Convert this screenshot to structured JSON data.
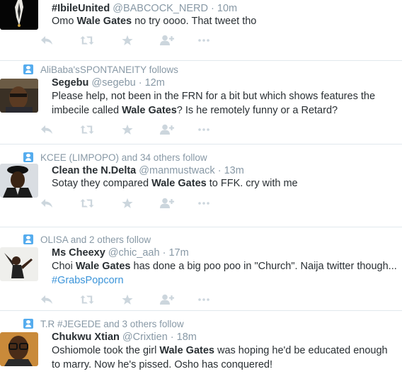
{
  "colors": {
    "icon": "#ccd6dd",
    "accent": "#55acee",
    "link": "#3b94d9",
    "muted": "#8899a6",
    "text": "#292f33",
    "divider": "#e1e8ed"
  },
  "tweets": [
    {
      "social": "",
      "fullname": "#IbileUnited",
      "username": "@BABCOCK_NERD",
      "sep": " · ",
      "time": "10m",
      "text_parts": [
        "Omo ",
        "Wale Gates",
        " no try oooo. That tweet tho"
      ],
      "avatar": "black-ribbon"
    },
    {
      "social": "AliBaba'sSPONTANEITY follows",
      "fullname": "Segebu",
      "username": "@segebu",
      "sep": " · ",
      "time": "12m",
      "text_parts": [
        "Please help, not been in the FRN for a bit but which shows features the imbecile called ",
        "Wale Gates",
        "? Is he remotely funny or a Retard?"
      ],
      "avatar": "man-portrait"
    },
    {
      "social": "KCEE (LIMPOPO) and 34 others follow",
      "fullname": "Clean the N.Delta",
      "username": "@manmustwack",
      "sep": " · ",
      "time": "13m",
      "text_parts": [
        "Sotay they compared ",
        "Wale Gates",
        " to FFK. cry with me"
      ],
      "avatar": "hat-man"
    },
    {
      "social": "OLISA and 2 others follow",
      "fullname": "Ms Cheexy",
      "username": "@chic_aah",
      "sep": " · ",
      "time": "17m",
      "text_parts": [
        "Choi ",
        "Wale Gates",
        " has done a big poo poo in \"Church\". Naija twitter though..."
      ],
      "hashtag": "#GrabsPopcorn",
      "avatar": "woman-dancing"
    },
    {
      "social": "T.R #JEGEDE and 3 others follow",
      "fullname": "Chukwu Xtian",
      "username": "@Crixtien",
      "sep": " · ",
      "time": "18m",
      "text_parts": [
        "Oshiomole took the girl ",
        "Wale Gates",
        " was hoping he'd be educated enough to marry. Now he's pissed. Osho has conquered!"
      ],
      "avatar": "man-glasses"
    }
  ]
}
